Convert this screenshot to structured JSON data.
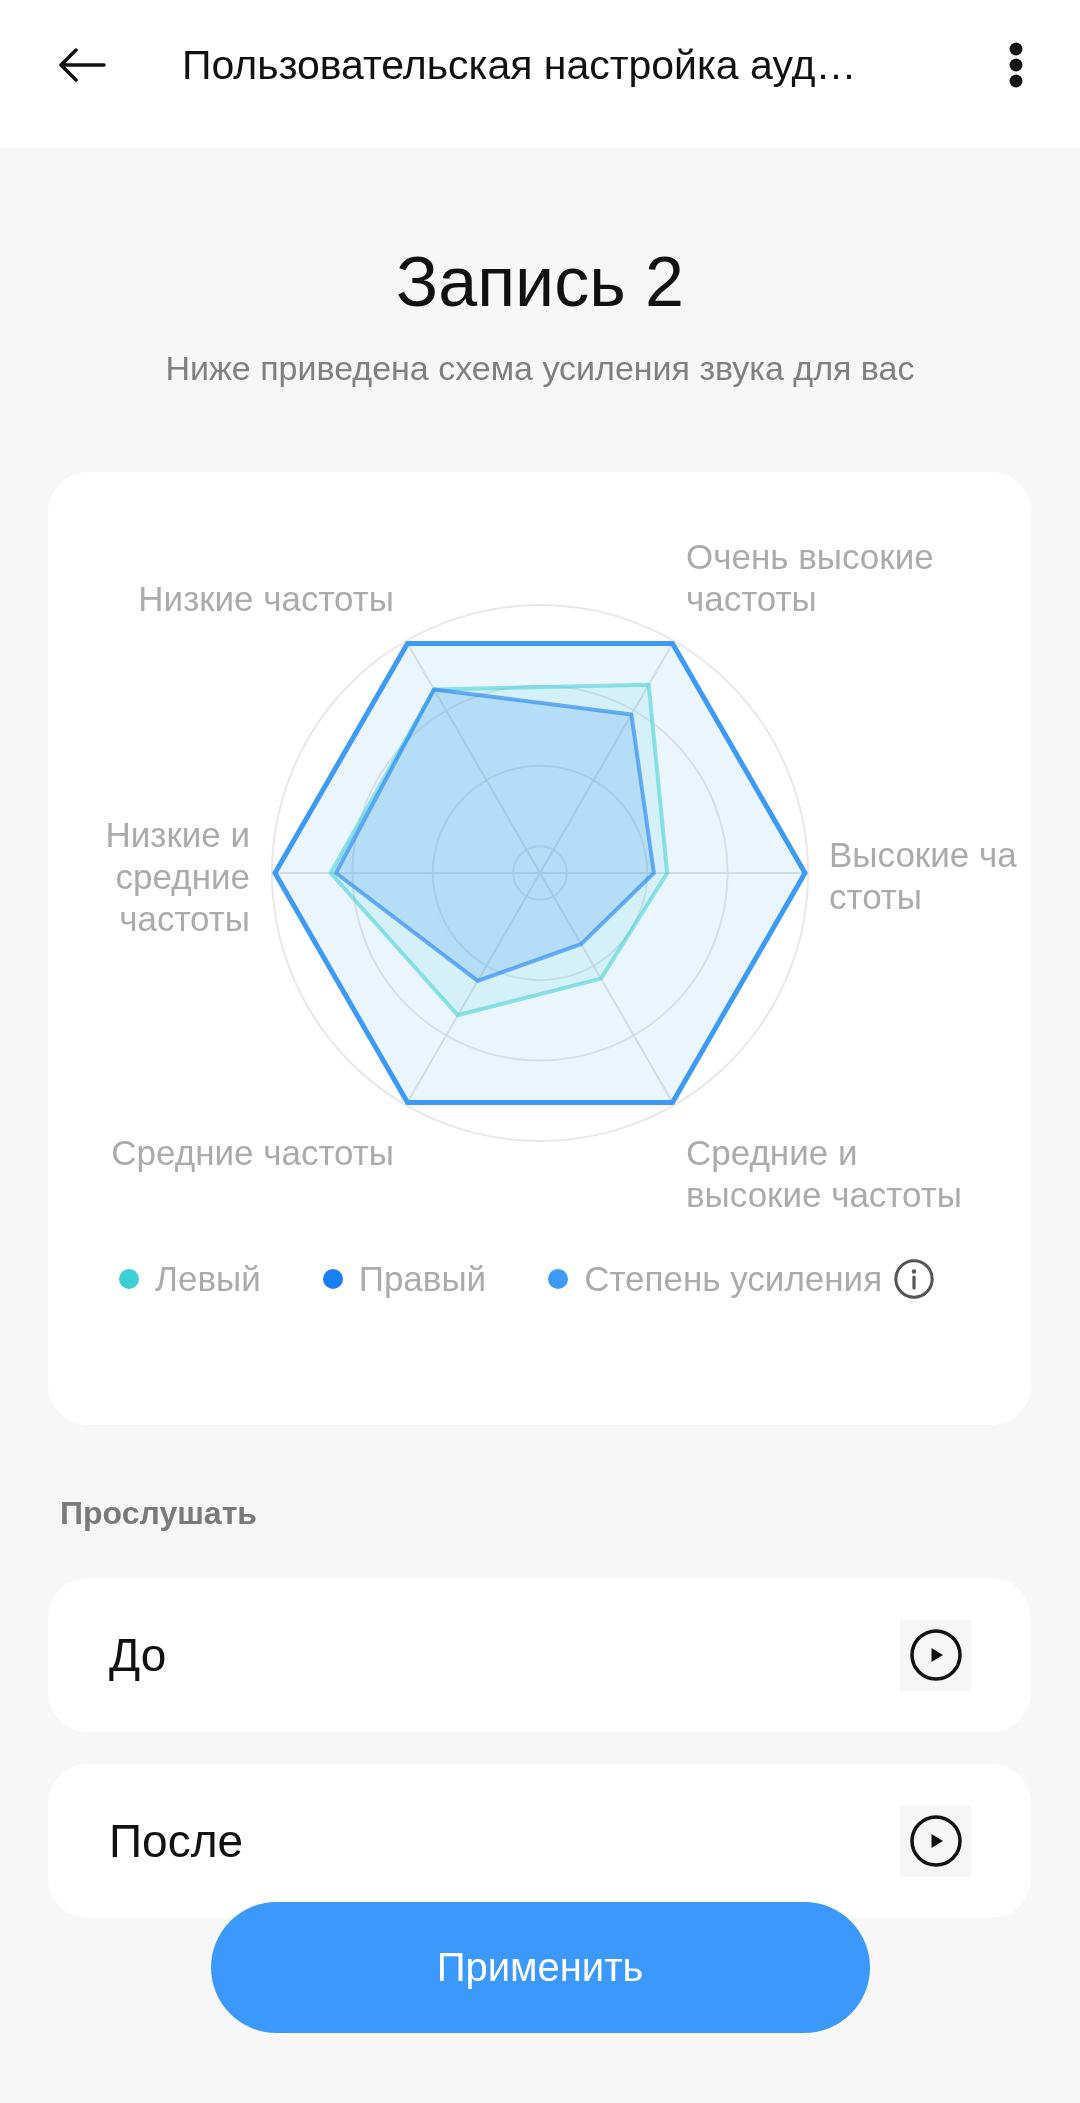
{
  "app_bar": {
    "title": "Пользовательская настройка ауд…"
  },
  "heading": {
    "title": "Запись 2",
    "subtitle": "Ниже приведена схема усиления звука для вас"
  },
  "chart": {
    "axes": [
      "Низкие частоты",
      "Очень высокие частоты",
      "Низкие и средние частоты",
      "Высокие частоты",
      "Средние частоты",
      "Средние и высокие частоты"
    ],
    "legend": [
      {
        "label": "Левый",
        "color": "#3ccfd4"
      },
      {
        "label": "Правый",
        "color": "#1a7ff5"
      },
      {
        "label": "Степень усиления",
        "color": "#3d9bf7"
      }
    ]
  },
  "listen": {
    "title": "Прослушать",
    "items": [
      {
        "label": "До"
      },
      {
        "label": "После"
      }
    ]
  },
  "apply_button": {
    "label": "Применить"
  }
}
